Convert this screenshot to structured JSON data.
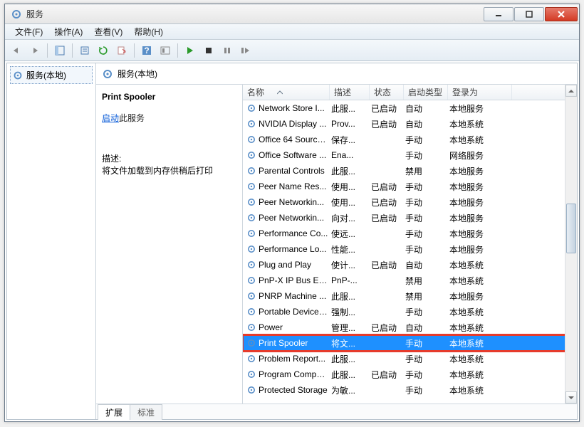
{
  "title": "服务",
  "menus": [
    "文件(F)",
    "操作(A)",
    "查看(V)",
    "帮助(H)"
  ],
  "tree_label": "服务(本地)",
  "header_label": "服务(本地)",
  "detail": {
    "title": "Print Spooler",
    "action_link": "启动",
    "action_suffix": "此服务",
    "desc_label": "描述:",
    "desc_text": "将文件加载到内存供稍后打印"
  },
  "columns": [
    "名称",
    "描述",
    "状态",
    "启动类型",
    "登录为"
  ],
  "rows": [
    {
      "name": "Network Store I...",
      "desc": "此服...",
      "status": "已启动",
      "start": "自动",
      "logon": "本地服务"
    },
    {
      "name": "NVIDIA Display ...",
      "desc": "Prov...",
      "status": "已启动",
      "start": "自动",
      "logon": "本地系统"
    },
    {
      "name": "Office 64 Source...",
      "desc": "保存...",
      "status": "",
      "start": "手动",
      "logon": "本地系统"
    },
    {
      "name": "Office Software ...",
      "desc": "Ena...",
      "status": "",
      "start": "手动",
      "logon": "网络服务"
    },
    {
      "name": "Parental Controls",
      "desc": "此服...",
      "status": "",
      "start": "禁用",
      "logon": "本地服务"
    },
    {
      "name": "Peer Name Res...",
      "desc": "使用...",
      "status": "已启动",
      "start": "手动",
      "logon": "本地服务"
    },
    {
      "name": "Peer Networkin...",
      "desc": "使用...",
      "status": "已启动",
      "start": "手动",
      "logon": "本地服务"
    },
    {
      "name": "Peer Networkin...",
      "desc": "向对...",
      "status": "已启动",
      "start": "手动",
      "logon": "本地服务"
    },
    {
      "name": "Performance Co...",
      "desc": "使远...",
      "status": "",
      "start": "手动",
      "logon": "本地服务"
    },
    {
      "name": "Performance Lo...",
      "desc": "性能...",
      "status": "",
      "start": "手动",
      "logon": "本地服务"
    },
    {
      "name": "Plug and Play",
      "desc": "使计...",
      "status": "已启动",
      "start": "自动",
      "logon": "本地系统"
    },
    {
      "name": "PnP-X IP Bus En...",
      "desc": "PnP-...",
      "status": "",
      "start": "禁用",
      "logon": "本地系统"
    },
    {
      "name": "PNRP Machine ...",
      "desc": "此服...",
      "status": "",
      "start": "禁用",
      "logon": "本地服务"
    },
    {
      "name": "Portable Device ...",
      "desc": "强制...",
      "status": "",
      "start": "手动",
      "logon": "本地系统"
    },
    {
      "name": "Power",
      "desc": "管理...",
      "status": "已启动",
      "start": "自动",
      "logon": "本地系统"
    },
    {
      "name": "Print Spooler",
      "desc": "将文...",
      "status": "",
      "start": "手动",
      "logon": "本地系统",
      "selected": true
    },
    {
      "name": "Problem Report...",
      "desc": "此服...",
      "status": "",
      "start": "手动",
      "logon": "本地系统"
    },
    {
      "name": "Program Compa...",
      "desc": "此服...",
      "status": "已启动",
      "start": "手动",
      "logon": "本地系统"
    },
    {
      "name": "Protected Storage",
      "desc": "为敏...",
      "status": "",
      "start": "手动",
      "logon": "本地系统"
    }
  ],
  "tabs": [
    "扩展",
    "标准"
  ]
}
